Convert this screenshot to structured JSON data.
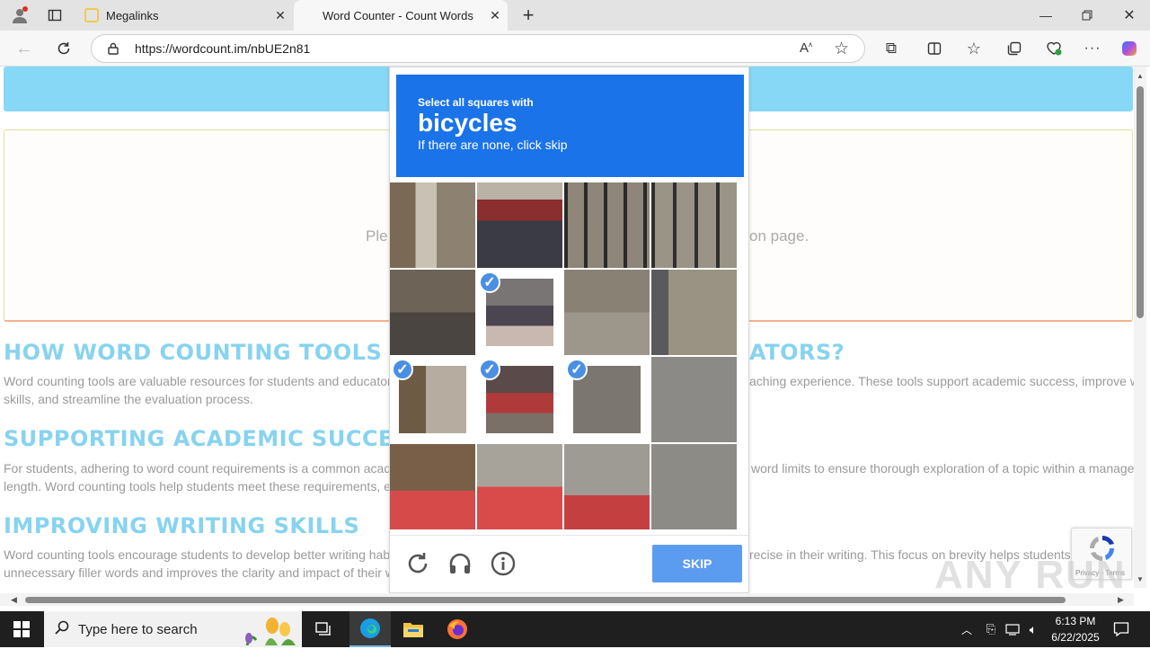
{
  "browser": {
    "tabs": [
      {
        "title": "Megalinks",
        "active": false
      },
      {
        "title": "Word Counter - Count Words",
        "active": true
      }
    ],
    "url": "https://wordcount.im/nbUE2n81"
  },
  "page": {
    "notice_left": "Ple",
    "notice_right": "on page.",
    "sections": [
      {
        "heading": "HOW WORD COUNTING TOOLS B",
        "heading_tail": "ATORS?",
        "lines": [
          "Word counting tools are valuable resources for students and educator",
          "skills, and streamline the evaluation process."
        ],
        "line_tail": "aching experience. These tools support academic success, improve w"
      },
      {
        "heading": "SUPPORTING ACADEMIC SUCCE",
        "heading_tail": "",
        "lines": [
          "For students, adhering to word count requirements is a common acad",
          "length. Word counting tools help students meet these requirements, e"
        ],
        "line_tail": "word limits to ensure thorough exploration of a topic within a manage"
      },
      {
        "heading": "IMPROVING WRITING SKILLS",
        "heading_tail": "",
        "lines": [
          "Word counting tools encourage students to develop better writing hab",
          "unnecessary filler words and improves the clarity and impact of their w"
        ],
        "line_tail": "recise in their writing. This focus on brevity helps students"
      }
    ]
  },
  "captcha": {
    "instruction": "Select all squares with",
    "target": "bicycles",
    "hint": "If there are none, click skip",
    "skip_label": "SKIP",
    "selected_tiles": [
      5,
      8,
      9,
      10
    ]
  },
  "watermark": "ANY RUN",
  "recaptcha_terms": "Privacy - Terms",
  "taskbar": {
    "search_placeholder": "Type here to search",
    "time": "6:13 PM",
    "date": "6/22/2025"
  },
  "colors": {
    "accent": "#1a73e8",
    "heading": "#87d3f0",
    "banner": "#87d8f7"
  }
}
